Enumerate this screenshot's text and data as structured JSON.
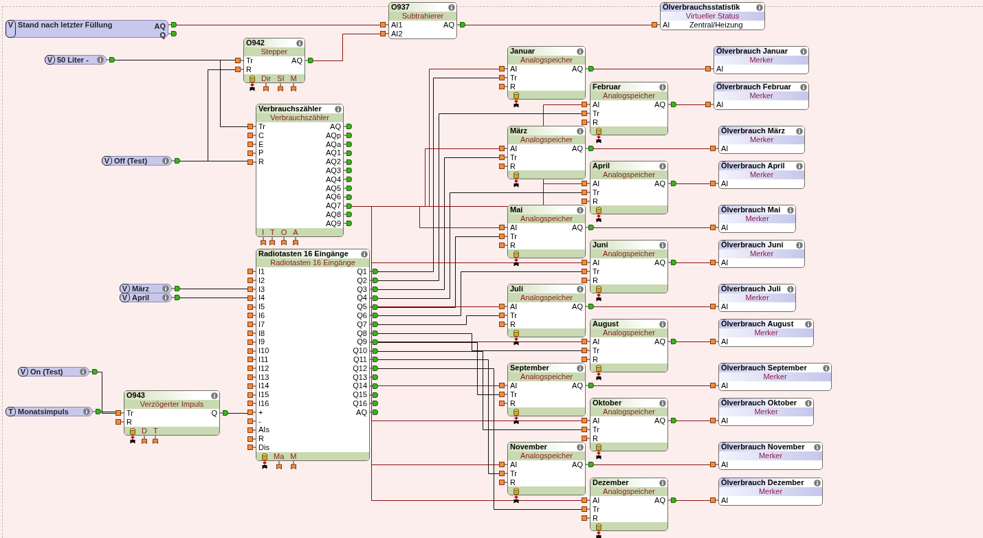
{
  "variables": [
    {
      "badge": "V",
      "label": "Stand nach letzter Füllung",
      "info_button": false,
      "outputs": [
        "AQ",
        "Q"
      ]
    },
    {
      "badge": "V",
      "label": "50 Liter -",
      "info_button": true
    },
    {
      "badge": "V",
      "label": "Off (Test)",
      "info_button": true
    },
    {
      "badge": "V",
      "label": "März",
      "info_button": true
    },
    {
      "badge": "V",
      "label": "April",
      "info_button": true
    },
    {
      "badge": "V",
      "label": "On (Test)",
      "info_button": true
    },
    {
      "badge": "T",
      "label": "Monatsimpuls",
      "info_button": true
    }
  ],
  "blocks": [
    {
      "title": "O937",
      "subtitle": "Subtrahierer",
      "inputs": [
        "AI1",
        "AI2"
      ],
      "outputs": [
        "AQ"
      ],
      "lock": false
    },
    {
      "title": "O942",
      "subtitle": "Stepper",
      "inputs": [
        "Tr",
        "R"
      ],
      "outputs": [
        "AQ"
      ],
      "lock": true,
      "params": [
        "Dir",
        "SI",
        "M"
      ]
    },
    {
      "title": "Verbrauchszähler",
      "subtitle": "Verbrauchszähler",
      "inputs": [
        "Tr",
        "C",
        "E",
        "P",
        "R"
      ],
      "outputs": [
        "AQ",
        "AQp",
        "AQa",
        "AQ1",
        "AQ2",
        "AQ3",
        "AQ4",
        "AQ5",
        "AQ6",
        "AQ7",
        "AQ8",
        "AQ9"
      ],
      "lock": false,
      "params": [
        "I",
        "T",
        "O",
        "A"
      ]
    },
    {
      "title": "O943",
      "subtitle": "Verzögerter Impuls",
      "inputs": [
        "Tr",
        "R"
      ],
      "outputs": [
        "Q"
      ],
      "lock": true,
      "params": [
        "D",
        "T"
      ]
    },
    {
      "title": "Radiotasten 16 Eingänge",
      "subtitle": "Radiotasten 16 Eingänge",
      "inputs": [
        "I1",
        "I2",
        "I3",
        "I4",
        "I5",
        "I6",
        "I7",
        "I8",
        "I9",
        "I10",
        "I11",
        "I12",
        "I13",
        "I14",
        "I15",
        "I16",
        "+",
        "-",
        "AIs",
        "R",
        "Dis"
      ],
      "outputs": [
        "Q1",
        "Q2",
        "Q3",
        "Q4",
        "Q5",
        "Q6",
        "Q7",
        "Q8",
        "Q9",
        "Q10",
        "Q11",
        "Q12",
        "Q13",
        "Q14",
        "Q15",
        "Q16",
        "AQ"
      ],
      "lock": true,
      "params": [
        "Ma",
        "M"
      ]
    }
  ],
  "status_block": {
    "title": "Ölverbrauchsstatistik",
    "subtitle": "Virtueller Status",
    "inputs": [
      "AI"
    ],
    "value": "Zentral/Heizung"
  },
  "months": [
    {
      "store": {
        "title": "Januar",
        "subtitle": "Analogspeicher",
        "inputs": [
          "AI",
          "Tr",
          "R"
        ],
        "outputs": [
          "AQ"
        ],
        "lock": true
      },
      "marker": {
        "title": "Ölverbrauch Januar",
        "subtitle": "Merker",
        "inputs": [
          "AI"
        ]
      }
    },
    {
      "store": {
        "title": "Februar",
        "subtitle": "Analogspeicher",
        "inputs": [
          "AI",
          "Tr",
          "R"
        ],
        "outputs": [
          "AQ"
        ],
        "lock": true
      },
      "marker": {
        "title": "Ölverbrauch Februar",
        "subtitle": "Merker",
        "inputs": [
          "AI"
        ]
      }
    },
    {
      "store": {
        "title": "März",
        "subtitle": "Analogspeicher",
        "inputs": [
          "AI",
          "Tr",
          "R"
        ],
        "outputs": [
          "AQ"
        ],
        "lock": true
      },
      "marker": {
        "title": "Ölverbrauch März",
        "subtitle": "Merker",
        "inputs": [
          "AI"
        ]
      }
    },
    {
      "store": {
        "title": "April",
        "subtitle": "Analogspeicher",
        "inputs": [
          "AI",
          "Tr",
          "R"
        ],
        "outputs": [
          "AQ"
        ],
        "lock": true
      },
      "marker": {
        "title": "Ölverbrauch April",
        "subtitle": "Merker",
        "inputs": [
          "AI"
        ]
      }
    },
    {
      "store": {
        "title": "Mai",
        "subtitle": "Analogspeicher",
        "inputs": [
          "AI",
          "Tr",
          "R"
        ],
        "outputs": [
          "AQ"
        ],
        "lock": true
      },
      "marker": {
        "title": "Ölverbrauch Mai",
        "subtitle": "Merker",
        "inputs": [
          "AI"
        ]
      }
    },
    {
      "store": {
        "title": "Juni",
        "subtitle": "Analogspeicher",
        "inputs": [
          "AI",
          "Tr",
          "R"
        ],
        "outputs": [
          "AQ"
        ],
        "lock": true
      },
      "marker": {
        "title": "Ölverbrauch Juni",
        "subtitle": "Merker",
        "inputs": [
          "AI"
        ]
      }
    },
    {
      "store": {
        "title": "Juli",
        "subtitle": "Analogspeicher",
        "inputs": [
          "AI",
          "Tr",
          "R"
        ],
        "outputs": [
          "AQ"
        ],
        "lock": true
      },
      "marker": {
        "title": "Ölverbrauch Juli",
        "subtitle": "Merker",
        "inputs": [
          "AI"
        ]
      }
    },
    {
      "store": {
        "title": "August",
        "subtitle": "Analogspeicher",
        "inputs": [
          "AI",
          "Tr",
          "R"
        ],
        "outputs": [
          "AQ"
        ],
        "lock": true
      },
      "marker": {
        "title": "Ölverbrauch August",
        "subtitle": "Merker",
        "inputs": [
          "AI"
        ]
      }
    },
    {
      "store": {
        "title": "September",
        "subtitle": "Analogspeicher",
        "inputs": [
          "AI",
          "Tr",
          "R"
        ],
        "outputs": [
          "AQ"
        ],
        "lock": true
      },
      "marker": {
        "title": "Ölverbrauch September",
        "subtitle": "Merker",
        "inputs": [
          "AI"
        ]
      }
    },
    {
      "store": {
        "title": "Oktober",
        "subtitle": "Analogspeicher",
        "inputs": [
          "AI",
          "Tr",
          "R"
        ],
        "outputs": [
          "AQ"
        ],
        "lock": true
      },
      "marker": {
        "title": "Ölverbrauch Oktober",
        "subtitle": "Merker",
        "inputs": [
          "AI"
        ]
      }
    },
    {
      "store": {
        "title": "November",
        "subtitle": "Analogspeicher",
        "inputs": [
          "AI",
          "Tr",
          "R"
        ],
        "outputs": [
          "AQ"
        ],
        "lock": true
      },
      "marker": {
        "title": "Ölverbrauch November",
        "subtitle": "Merker",
        "inputs": [
          "AI"
        ]
      }
    },
    {
      "store": {
        "title": "Dezember",
        "subtitle": "Analogspeicher",
        "inputs": [
          "AI",
          "Tr",
          "R"
        ],
        "outputs": [
          "AQ"
        ],
        "lock": true
      },
      "marker": {
        "title": "Ölverbrauch Dezember",
        "subtitle": "Merker",
        "inputs": [
          "AI"
        ]
      }
    }
  ]
}
